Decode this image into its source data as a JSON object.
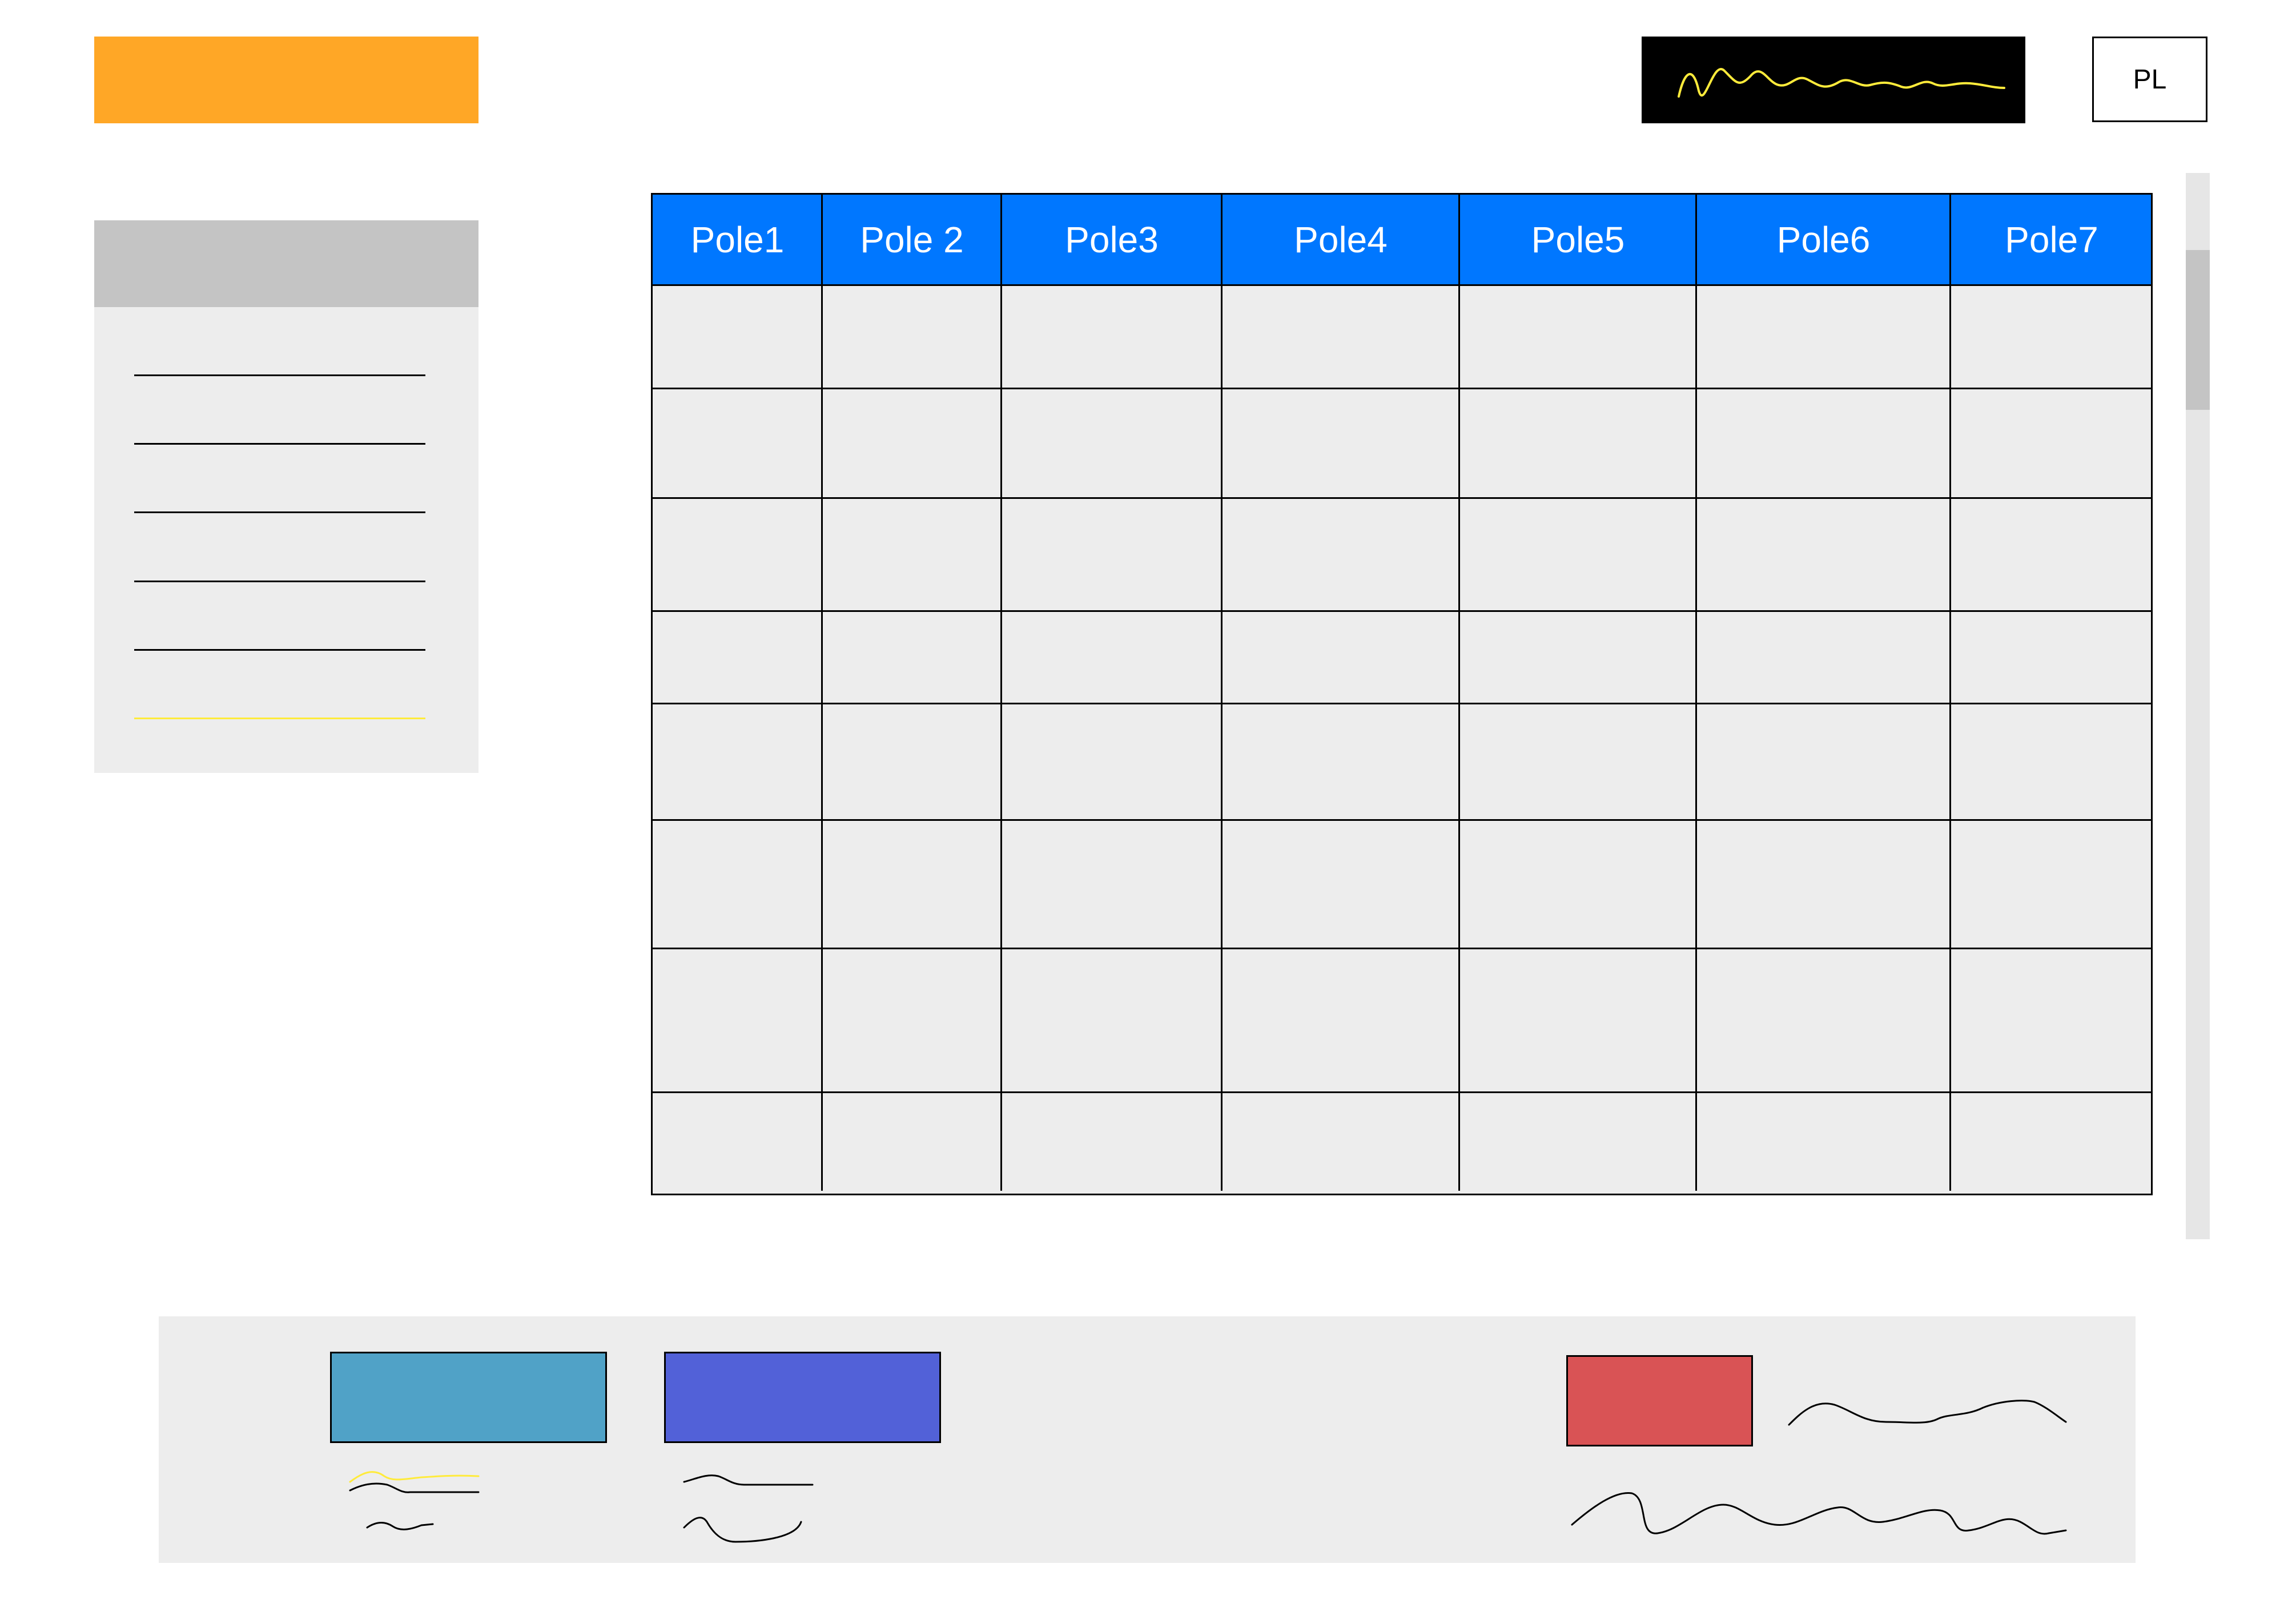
{
  "header": {
    "language_button": "PL"
  },
  "sidebar": {
    "items": [
      {
        "state": "normal"
      },
      {
        "state": "normal"
      },
      {
        "state": "normal"
      },
      {
        "state": "normal"
      },
      {
        "state": "normal"
      },
      {
        "state": "active"
      }
    ]
  },
  "table": {
    "columns": [
      "Pole1",
      "Pole 2",
      "Pole3",
      "Pole4",
      "Pole5",
      "Pole6",
      "Pole7"
    ],
    "row_count": 8
  },
  "footer": {
    "buttons": [
      {
        "name": "teal-button",
        "color": "#50A2C7"
      },
      {
        "name": "blue-button",
        "color": "#5261D8"
      },
      {
        "name": "red-button",
        "color": "#D95355"
      }
    ]
  },
  "colors": {
    "logo": "#FFA726",
    "table_header": "#0077FF",
    "highlight": "#FFEB3B",
    "panel_bg": "#EDEDED"
  }
}
